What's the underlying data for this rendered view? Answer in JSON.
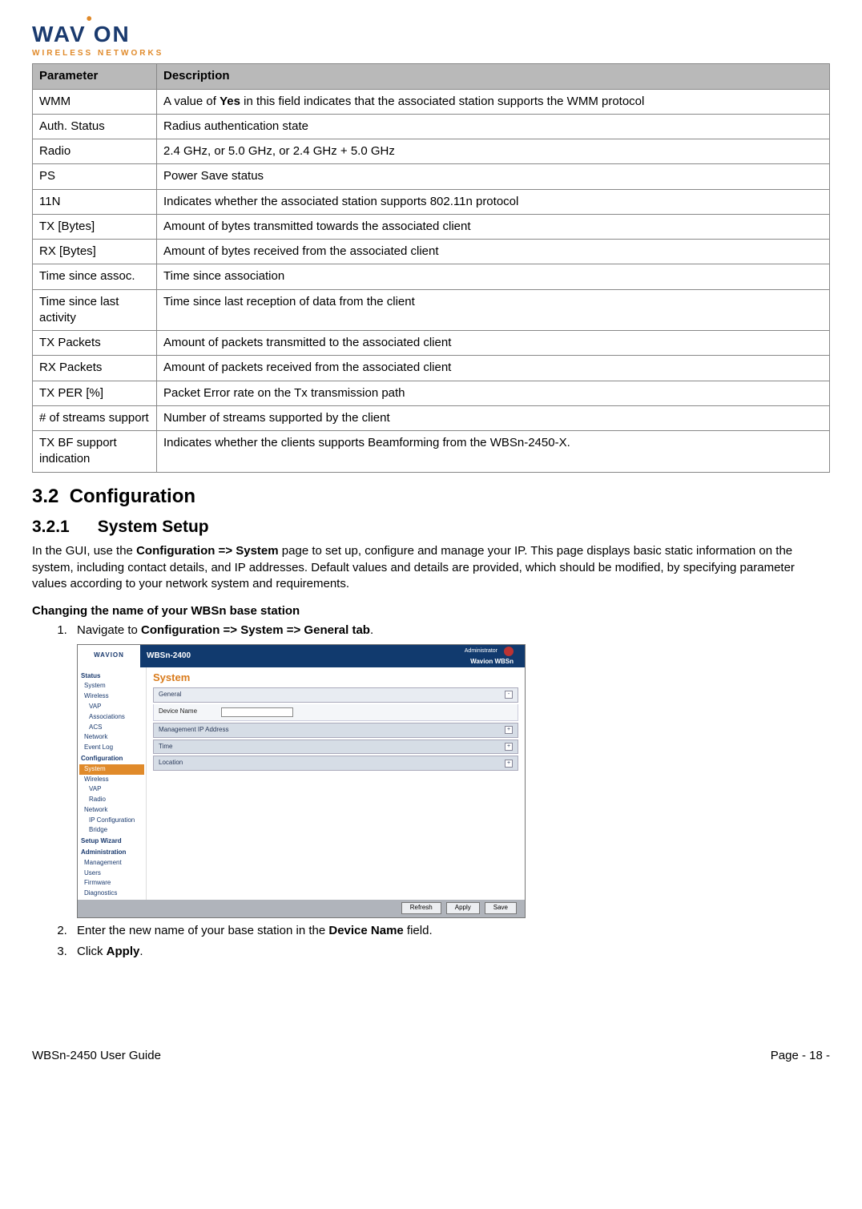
{
  "logo": {
    "prefix": "WAV",
    "dot": "•",
    "suffix": "ON",
    "sub": "WIRELESS NETWORKS"
  },
  "table": {
    "headers": {
      "param": "Parameter",
      "desc": "Description"
    },
    "rows": [
      {
        "param": "WMM",
        "desc_pre": "A value of ",
        "desc_bold": "Yes",
        "desc_post": " in this field indicates that the associated station supports the WMM protocol"
      },
      {
        "param": "Auth. Status",
        "desc": "Radius authentication state"
      },
      {
        "param": "Radio",
        "desc": "2.4 GHz, or 5.0 GHz, or 2.4 GHz + 5.0 GHz"
      },
      {
        "param": "PS",
        "desc": "Power Save status"
      },
      {
        "param": "11N",
        "desc": "Indicates whether the associated station supports 802.11n protocol"
      },
      {
        "param": "TX [Bytes]",
        "desc": "Amount of bytes transmitted towards the associated client"
      },
      {
        "param": "RX [Bytes]",
        "desc": "Amount of bytes received from the associated client"
      },
      {
        "param": "Time since assoc.",
        "desc": "Time since association"
      },
      {
        "param": "Time since last activity",
        "desc": "Time since last reception of data from the client"
      },
      {
        "param": "TX Packets",
        "desc": "Amount of packets transmitted to the associated client"
      },
      {
        "param": "RX Packets",
        "desc": "Amount of packets received from the associated client"
      },
      {
        "param": "TX PER [%]",
        "desc": "Packet Error rate on the Tx transmission path"
      },
      {
        "param": "# of streams support",
        "desc": "Number of streams supported by the client"
      },
      {
        "param": "TX BF support indication",
        "desc": "Indicates whether the clients supports Beamforming from the WBSn-2450-X."
      }
    ]
  },
  "section": {
    "num": "3.2",
    "title": "Configuration"
  },
  "subsection": {
    "num": "3.2.1",
    "title": "System Setup"
  },
  "intro": {
    "pre": "In the GUI, use the ",
    "bold": "Configuration => System",
    "post": " page to set up, configure and manage your IP. This page displays basic static information on the system, including contact details, and IP addresses. Default values and details are provided, which should be modified, by specifying parameter values according to your network system and requirements."
  },
  "subhead": "Changing the name of your WBSn base station",
  "steps": {
    "s1": {
      "pre": "Navigate to ",
      "bold": "Configuration => System => General tab",
      "post": "."
    },
    "s2": {
      "pre": "Enter the new name of your base station in the ",
      "bold": "Device Name",
      "post": " field."
    },
    "s3": {
      "pre": "Click ",
      "bold": "Apply",
      "post": "."
    }
  },
  "embed": {
    "logo": "WAVION",
    "device": "WBSn-2400",
    "admin": "Administrator",
    "sub": "Wavion WBSn",
    "page_title": "System",
    "sidebar": {
      "groups": [
        {
          "label": "Status",
          "items": [
            "System",
            "Wireless",
            "VAP",
            "Associations",
            "ACS",
            "Network",
            "Event Log"
          ]
        },
        {
          "label": "Configuration",
          "items_pre": [],
          "selected": "System",
          "items_post": [
            "Wireless",
            "VAP",
            "Radio",
            "Network",
            "IP Configuration",
            "Bridge"
          ]
        },
        {
          "label": "Setup Wizard",
          "items": []
        },
        {
          "label": "Administration",
          "items": [
            "Management",
            "Users",
            "Firmware",
            "Diagnostics"
          ]
        }
      ]
    },
    "panels": {
      "general": "General",
      "device_name_label": "Device Name",
      "device_name_value": "",
      "mgmt": "Management IP Address",
      "time": "Time",
      "location": "Location"
    },
    "buttons": {
      "refresh": "Refresh",
      "apply": "Apply",
      "save": "Save"
    }
  },
  "footer": {
    "left": "WBSn-2450 User Guide",
    "right": "Page - 18 -"
  }
}
